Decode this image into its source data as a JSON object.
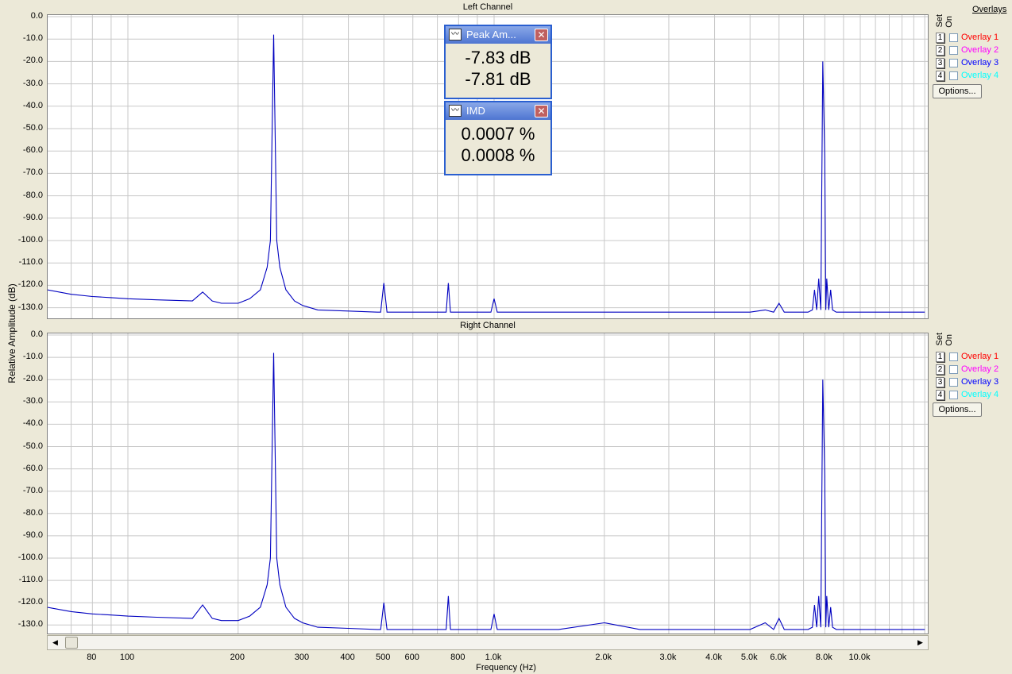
{
  "y_axis_label": "Relative Amplitude (dB)",
  "x_axis_label": "Frequency (Hz)",
  "y_tick_labels": [
    "0.0",
    "-10.0",
    "-20.0",
    "-30.0",
    "-40.0",
    "-50.0",
    "-60.0",
    "-70.0",
    "-80.0",
    "-90.0",
    "-100.0",
    "-110.0",
    "-120.0",
    "-130.0"
  ],
  "x_tick_labels": [
    {
      "label": "80",
      "f": 80
    },
    {
      "label": "100",
      "f": 100
    },
    {
      "label": "200",
      "f": 200
    },
    {
      "label": "300",
      "f": 300
    },
    {
      "label": "400",
      "f": 400
    },
    {
      "label": "500",
      "f": 500
    },
    {
      "label": "600",
      "f": 600
    },
    {
      "label": "800",
      "f": 800
    },
    {
      "label": "1.0k",
      "f": 1000
    },
    {
      "label": "2.0k",
      "f": 2000
    },
    {
      "label": "3.0k",
      "f": 3000
    },
    {
      "label": "4.0k",
      "f": 4000
    },
    {
      "label": "5.0k",
      "f": 5000
    },
    {
      "label": "6.0k",
      "f": 6000
    },
    {
      "label": "8.0k",
      "f": 8000
    },
    {
      "label": "10.0k",
      "f": 10000
    }
  ],
  "overlays_panel": {
    "title": "Overlays",
    "set_label": "Set",
    "on_label": "On",
    "items": [
      {
        "num": "1",
        "label": "Overlay 1",
        "color": "#ff0000"
      },
      {
        "num": "2",
        "label": "Overlay 2",
        "color": "#ff00ff"
      },
      {
        "num": "3",
        "label": "Overlay 3",
        "color": "#0000ff"
      },
      {
        "num": "4",
        "label": "Overlay 4",
        "color": "#00ffff"
      }
    ],
    "options_label": "Options..."
  },
  "meters": {
    "peak": {
      "title": "Peak Am...",
      "values": [
        "-7.83 dB",
        "-7.81 dB"
      ]
    },
    "imd": {
      "title": "IMD",
      "values": [
        "0.0007 %",
        "0.0008 %"
      ]
    }
  },
  "chart_data": [
    {
      "type": "line",
      "title": "Left Channel",
      "xlabel": "Frequency (Hz)",
      "ylabel": "Relative Amplitude (dB)",
      "xscale": "log",
      "xlim": [
        60,
        15000
      ],
      "ylim": [
        -133,
        0
      ],
      "grid": true,
      "color": "#0000c0",
      "x": [
        60,
        70,
        80,
        90,
        100,
        120,
        150,
        160,
        170,
        180,
        200,
        215,
        230,
        240,
        245,
        250,
        255,
        260,
        270,
        285,
        300,
        330,
        400,
        480,
        490,
        500,
        510,
        520,
        600,
        730,
        740,
        750,
        760,
        770,
        800,
        950,
        980,
        1000,
        1020,
        1050,
        1500,
        2000,
        3000,
        4000,
        5000,
        5500,
        5800,
        6000,
        6200,
        6800,
        7200,
        7400,
        7500,
        7600,
        7700,
        7800,
        7900,
        8000,
        8050,
        8100,
        8200,
        8300,
        8400,
        8600,
        9000,
        10000,
        12000,
        14000,
        15000
      ],
      "y": [
        -122,
        -124,
        -125,
        -125.5,
        -126,
        -126.5,
        -127,
        -123,
        -127,
        -128,
        -128,
        -126,
        -122,
        -112,
        -100,
        -8,
        -100,
        -112,
        -122,
        -127,
        -129,
        -131,
        -131.5,
        -132,
        -132,
        -119,
        -132,
        -132,
        -132,
        -132,
        -132,
        -119,
        -132,
        -132,
        -132,
        -132,
        -132,
        -126,
        -132,
        -132,
        -132,
        -132,
        -132,
        -132,
        -132,
        -131,
        -132,
        -128,
        -132,
        -132,
        -132,
        -131,
        -122,
        -131,
        -117,
        -131,
        -20,
        -63,
        -131,
        -117,
        -131,
        -122,
        -131,
        -132,
        -132,
        -132,
        -132,
        -132,
        -132
      ]
    },
    {
      "type": "line",
      "title": "Right Channel",
      "xlabel": "Frequency (Hz)",
      "ylabel": "Relative Amplitude (dB)",
      "xscale": "log",
      "xlim": [
        60,
        15000
      ],
      "ylim": [
        -133,
        0
      ],
      "grid": true,
      "color": "#0000c0",
      "x": [
        60,
        70,
        80,
        90,
        100,
        120,
        150,
        160,
        170,
        180,
        200,
        215,
        230,
        240,
        245,
        250,
        255,
        260,
        270,
        285,
        300,
        330,
        400,
        480,
        490,
        500,
        510,
        520,
        600,
        730,
        740,
        750,
        760,
        770,
        800,
        950,
        980,
        1000,
        1020,
        1050,
        1500,
        2000,
        2500,
        3000,
        4000,
        5000,
        5500,
        5800,
        6000,
        6200,
        6800,
        7200,
        7400,
        7500,
        7600,
        7700,
        7800,
        7900,
        8000,
        8050,
        8100,
        8200,
        8300,
        8400,
        8600,
        9000,
        10000,
        12000,
        14000,
        15000
      ],
      "y": [
        -122,
        -124,
        -125,
        -125.5,
        -126,
        -126.5,
        -127,
        -121,
        -127,
        -128,
        -128,
        -126,
        -122,
        -112,
        -100,
        -8,
        -100,
        -112,
        -122,
        -127,
        -129,
        -131,
        -131.5,
        -132,
        -132,
        -120,
        -132,
        -132,
        -132,
        -132,
        -132,
        -117,
        -132,
        -132,
        -132,
        -132,
        -132,
        -125,
        -132,
        -132,
        -132,
        -129,
        -132,
        -132,
        -132,
        -132,
        -129,
        -132,
        -127,
        -132,
        -132,
        -132,
        -131,
        -121,
        -131,
        -117,
        -131,
        -20,
        -63,
        -131,
        -117,
        -131,
        -122,
        -131,
        -132,
        -132,
        -132,
        -132,
        -132,
        -132
      ]
    }
  ]
}
